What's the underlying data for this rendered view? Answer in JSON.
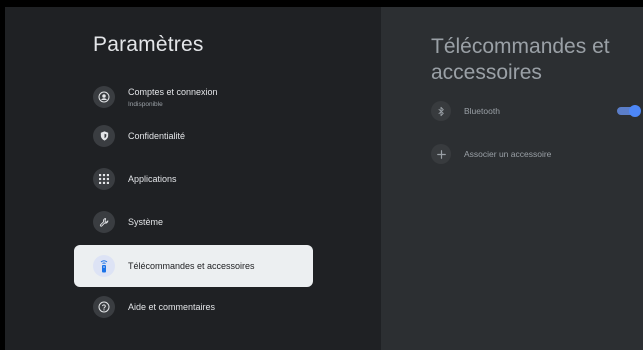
{
  "left_panel": {
    "title": "Paramètres",
    "items": [
      {
        "label": "Comptes et connexion",
        "sublabel": "Indisponible",
        "icon": "account-icon"
      },
      {
        "label": "Confidentialité",
        "icon": "privacy-shield-icon"
      },
      {
        "label": "Applications",
        "icon": "apps-grid-icon"
      },
      {
        "label": "Système",
        "icon": "wrench-icon"
      },
      {
        "label": "Télécommandes et accessoires",
        "icon": "remote-icon",
        "selected": true
      },
      {
        "label": "Aide et commentaires",
        "icon": "help-icon"
      }
    ]
  },
  "right_panel": {
    "title": "Télécommandes et accessoires",
    "bluetooth": {
      "label": "Bluetooth",
      "enabled": true,
      "icon": "bluetooth-icon"
    },
    "pair": {
      "label": "Associer un accessoire",
      "icon": "plus-icon"
    }
  },
  "colors": {
    "left_bg": "#1f2124",
    "right_bg": "#2c2f32",
    "accent": "#4d87f7"
  }
}
